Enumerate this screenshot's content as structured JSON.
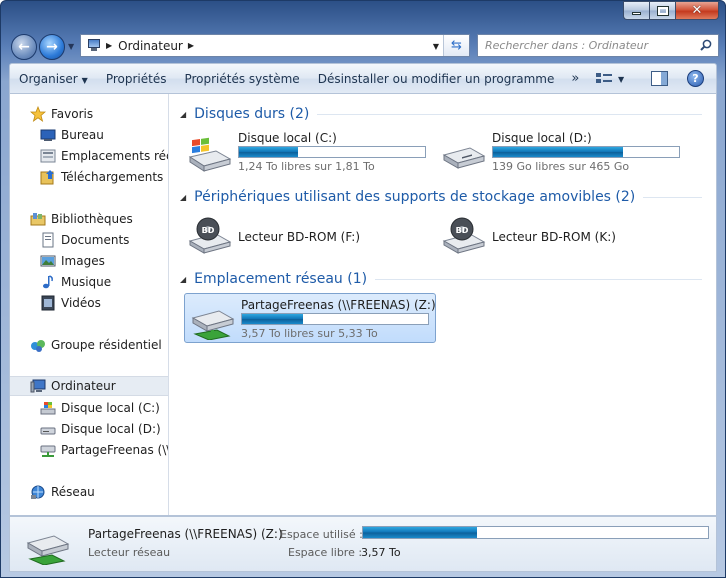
{
  "colors": {
    "accent": "#1e5ba8",
    "bar_fill": "#0f73b6",
    "selection": "#c1dcfc"
  },
  "address": {
    "location": "Ordinateur"
  },
  "search": {
    "placeholder": "Rechercher dans : Ordinateur"
  },
  "toolbar": {
    "items": [
      {
        "label": "Organiser",
        "has_dropdown": true
      },
      {
        "label": "Propriétés"
      },
      {
        "label": "Propriétés système"
      },
      {
        "label": "Désinstaller ou modifier un programme"
      }
    ],
    "more": "»",
    "icons": [
      "view-icon",
      "preview-pane-icon",
      "help-icon"
    ]
  },
  "nav": {
    "favorites": {
      "label": "Favoris",
      "icon": "star-icon",
      "items": [
        {
          "label": "Bureau",
          "icon": "desktop-icon"
        },
        {
          "label": "Emplacements récents",
          "icon": "recent-places-icon"
        },
        {
          "label": "Téléchargements",
          "icon": "downloads-icon"
        }
      ]
    },
    "libraries": {
      "label": "Bibliothèques",
      "icon": "library-icon",
      "items": [
        {
          "label": "Documents",
          "icon": "documents-icon"
        },
        {
          "label": "Images",
          "icon": "images-icon"
        },
        {
          "label": "Musique",
          "icon": "music-icon"
        },
        {
          "label": "Vidéos",
          "icon": "videos-icon"
        }
      ]
    },
    "homegroup": {
      "label": "Groupe résidentiel",
      "icon": "homegroup-icon"
    },
    "computer": {
      "label": "Ordinateur",
      "icon": "computer-icon",
      "selected": true,
      "items": [
        {
          "label": "Disque local (C:)",
          "icon": "windows-drive-icon"
        },
        {
          "label": "Disque local (D:)",
          "icon": "drive-icon"
        },
        {
          "label": "PartageFreenas (\\\\FREENAS) (Z:)",
          "icon": "network-drive-icon"
        }
      ]
    },
    "network": {
      "label": "Réseau",
      "icon": "network-icon"
    }
  },
  "groups": {
    "hard_drives": {
      "title": "Disques durs (2)",
      "drives": [
        {
          "name": "Disque local (C:)",
          "free_text": "1,24 To libres sur 1,81 To",
          "used_fraction": 0.315,
          "icon": "windows-drive-icon"
        },
        {
          "name": "Disque local (D:)",
          "free_text": "139 Go libres sur 465 Go",
          "used_fraction": 0.701,
          "icon": "drive-icon"
        }
      ]
    },
    "removable": {
      "title": "Périphériques utilisant des supports de stockage amovibles (2)",
      "drives": [
        {
          "name": "Lecteur BD-ROM (F:)",
          "icon": "bd-rom-icon",
          "badge": "BD"
        },
        {
          "name": "Lecteur BD-ROM (K:)",
          "icon": "bd-rom-icon",
          "badge": "BD"
        }
      ]
    },
    "network": {
      "title": "Emplacement réseau (1)",
      "drives": [
        {
          "name": "PartageFreenas (\\\\FREENAS) (Z:)",
          "free_text": "3,57 To libres sur 5,33 To",
          "used_fraction": 0.33,
          "icon": "network-drive-icon",
          "selected": true
        }
      ]
    }
  },
  "details": {
    "name": "PartageFreenas (\\\\FREENAS) (Z:)",
    "type": "Lecteur réseau",
    "used_label": "Espace utilisé :",
    "used_fraction": 0.33,
    "free_label": "Espace libre :",
    "free_value": "3,57 To",
    "icon": "network-drive-icon"
  }
}
